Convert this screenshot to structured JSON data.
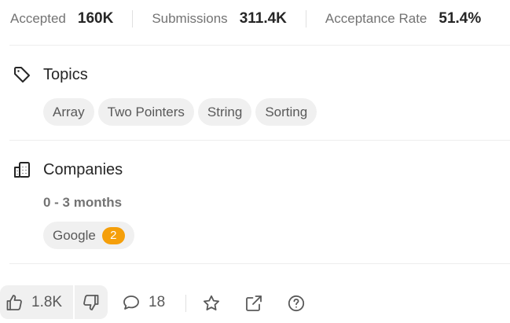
{
  "stats": {
    "accepted_label": "Accepted",
    "accepted_value": "160K",
    "submissions_label": "Submissions",
    "submissions_value": "311.4K",
    "acceptance_rate_label": "Acceptance Rate",
    "acceptance_rate_value": "51.4%"
  },
  "topics": {
    "title": "Topics",
    "icon": "tag-icon",
    "tags": [
      "Array",
      "Two Pointers",
      "String",
      "Sorting"
    ]
  },
  "companies": {
    "title": "Companies",
    "icon": "building-icon",
    "period": "0 - 3 months",
    "items": [
      {
        "name": "Google",
        "count": "2"
      }
    ]
  },
  "actions": {
    "likes": "1.8K",
    "comments": "18",
    "icons": [
      "thumbs-up-icon",
      "thumbs-down-icon",
      "comment-icon",
      "star-icon",
      "share-icon",
      "help-icon"
    ]
  },
  "colors": {
    "chip_bg": "#f0f0f0",
    "badge": "#f59f0a",
    "text_primary": "#262626",
    "text_secondary": "#737373"
  }
}
